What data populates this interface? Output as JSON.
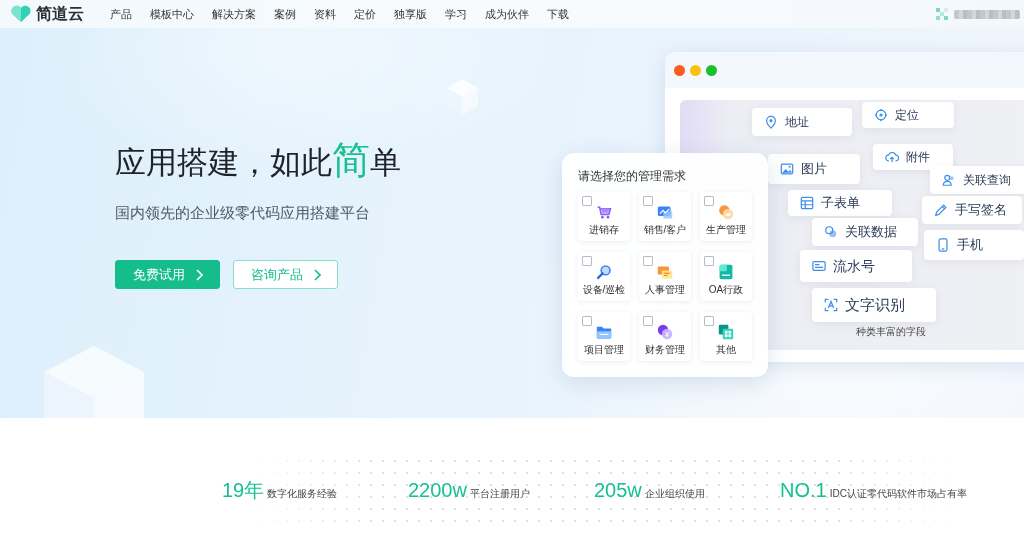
{
  "nav": {
    "logo": "简道云",
    "links": [
      "产品",
      "模板中心",
      "解决方案",
      "案例",
      "资料",
      "定价",
      "独享版",
      "学习",
      "成为伙伴",
      "下载"
    ]
  },
  "hero": {
    "title": [
      {
        "text": "应用搭建，如此",
        "highlight": false
      },
      {
        "text": "简",
        "highlight": true
      },
      {
        "text": "单",
        "highlight": false
      }
    ],
    "subtitle": "国内领先的企业级零代码应用搭建平台",
    "buttons": [
      {
        "label": "免费试用",
        "kind": "primary"
      },
      {
        "label": "咨询产品",
        "kind": "outline"
      }
    ]
  },
  "field_palette": {
    "fields": [
      "地址",
      "定位",
      "图片",
      "附件",
      "关联查询",
      "子表单",
      "手写签名",
      "关联数据",
      "手机",
      "流水号",
      "文字识别"
    ],
    "caption": "种类丰富的字段"
  },
  "needs_picker": {
    "title": "请选择您的管理需求",
    "options": [
      {
        "label": "进销存",
        "checked": false
      },
      {
        "label": "销售/客户",
        "checked": false
      },
      {
        "label": "生产管理",
        "checked": false
      },
      {
        "label": "设备/巡检",
        "checked": false
      },
      {
        "label": "人事管理",
        "checked": false
      },
      {
        "label": "OA行政",
        "checked": false
      },
      {
        "label": "项目管理",
        "checked": false
      },
      {
        "label": "财务管理",
        "checked": false
      },
      {
        "label": "其他",
        "checked": false
      }
    ]
  },
  "stats": [
    {
      "value": "19年",
      "label": "数字化服务经验"
    },
    {
      "value": "2200w",
      "label": "平台注册用户"
    },
    {
      "value": "205w",
      "label": "企业组织使用"
    },
    {
      "value": "NO.1",
      "label": "IDC认证零代码软件市场占有率"
    }
  ]
}
